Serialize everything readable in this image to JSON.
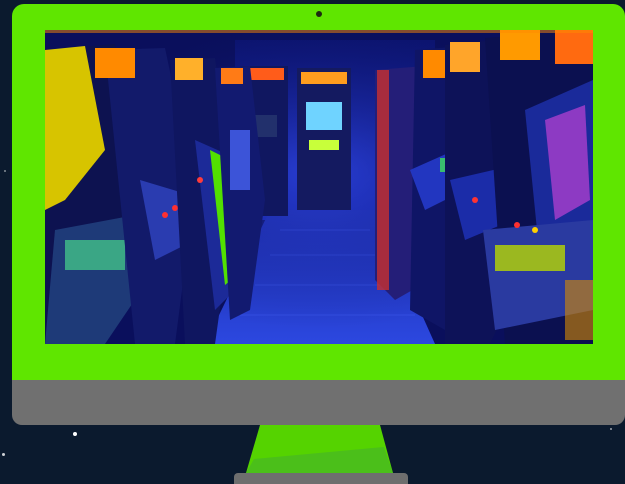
{
  "scene": {
    "background_color": "#0b1a2e",
    "monitor": {
      "bezel_color": "#5fe600",
      "chin_color": "#707070",
      "stand_colors": [
        "#55d300",
        "#4bbf1a"
      ],
      "base_color": "#6e6e6e"
    },
    "screen_image": {
      "subject": "arcade-hallway",
      "colors": [
        "#0a0f5c",
        "#1a2fd0",
        "#ff9a00",
        "#3fe000"
      ]
    },
    "icons": [
      "camera-icon"
    ]
  }
}
